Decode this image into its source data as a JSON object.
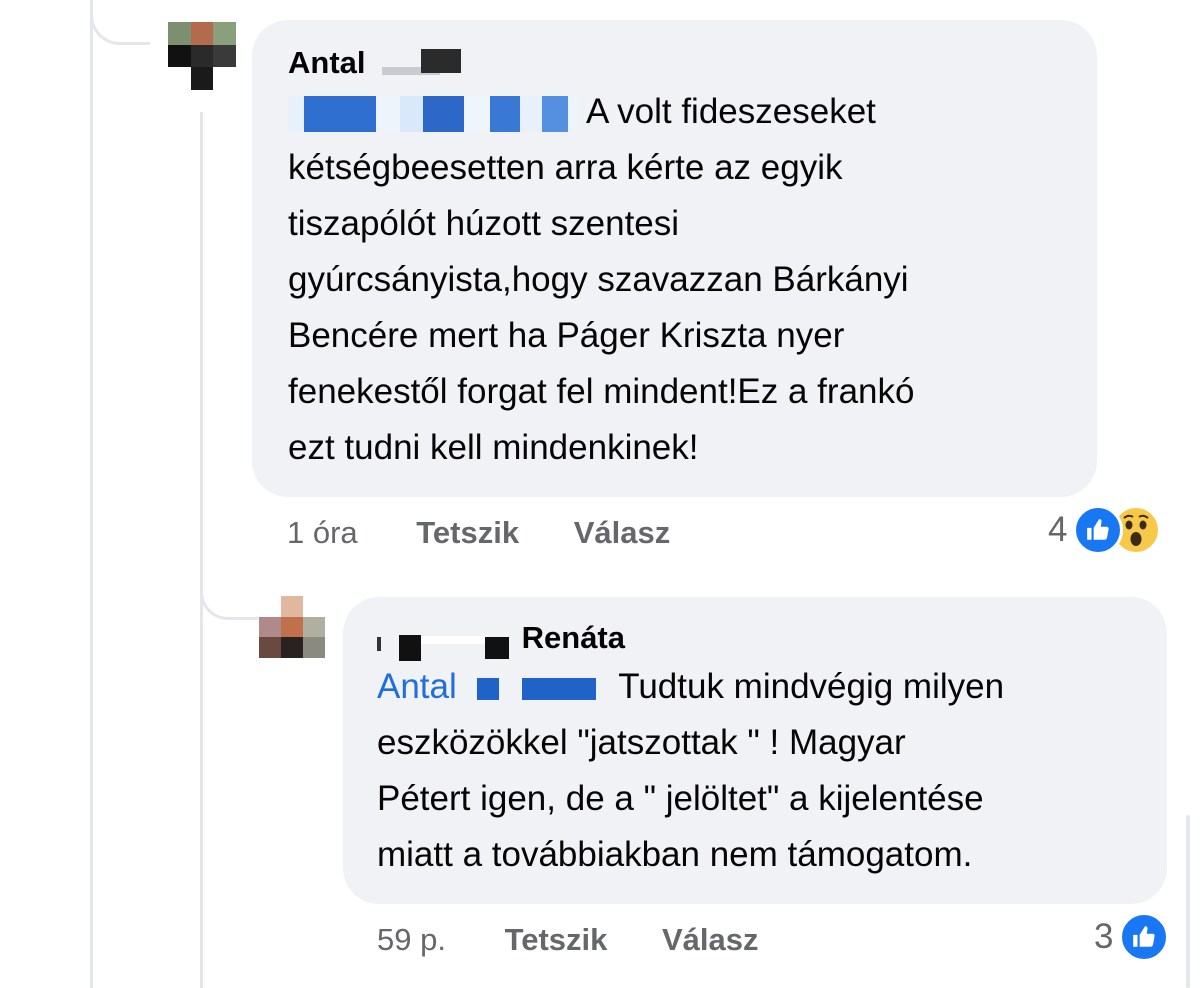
{
  "comments": [
    {
      "author": "Antal",
      "body_lines": [
        "A volt fideszeseket",
        "kétségbeesetten arra kérte az egyik",
        "tiszapólót húzott szentesi",
        "gyúrcsányista,hogy szavazzan Bárkányi",
        "Bencére mert ha Páger Kriszta nyer",
        "fenekestől forgat fel mindent!Ez a frankó",
        "ezt tudni kell mindenkinek!"
      ],
      "time": "1 óra",
      "like_label": "Tetszik",
      "reply_label": "Válasz",
      "reaction_count": "4",
      "reactions": [
        "like-icon",
        "wow-icon"
      ]
    },
    {
      "author": "Renáta",
      "mention": "Antal",
      "body_lines": [
        "Tudtuk mindvégig milyen",
        "eszközökkel \"jatszottak \" !  Magyar",
        "Pétert igen, de a \" jelöltet\" a kijelentése",
        "miatt a továbbiakban nem támogatom."
      ],
      "time": "59 p.",
      "like_label": "Tetszik",
      "reply_label": "Válasz",
      "reaction_count": "3",
      "reactions": [
        "like-icon"
      ]
    }
  ],
  "colors": {
    "bubble": "#f0f2f5",
    "meta_text": "#65676b",
    "mention": "#216fdb",
    "like": "#1877f2",
    "wow": "#f7c94a"
  }
}
